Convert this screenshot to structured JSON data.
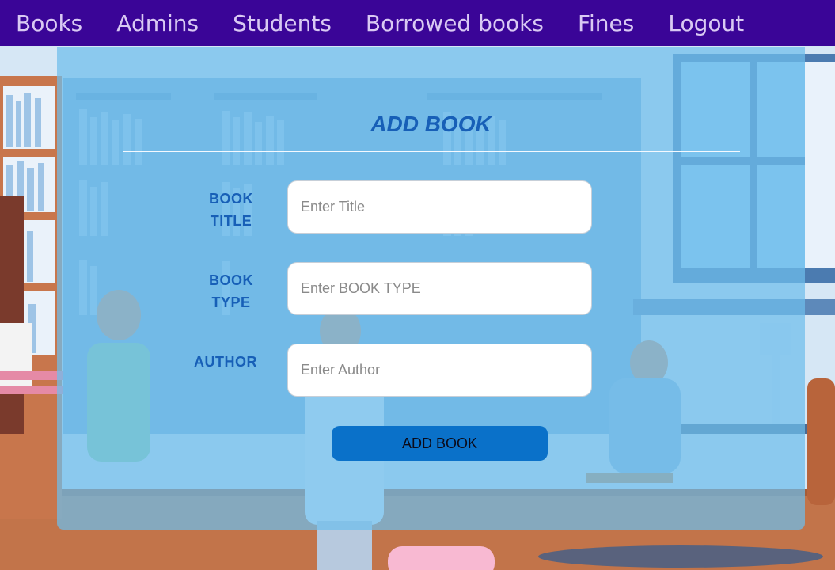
{
  "nav": {
    "items": [
      {
        "label": "Books"
      },
      {
        "label": "Admins"
      },
      {
        "label": "Students"
      },
      {
        "label": "Borrowed books"
      },
      {
        "label": "Fines"
      },
      {
        "label": "Logout"
      }
    ]
  },
  "form": {
    "title": "ADD BOOK",
    "fields": [
      {
        "label_line1": "BOOK",
        "label_line2": "TITLE",
        "placeholder": "Enter Title",
        "value": ""
      },
      {
        "label_line1": "BOOK",
        "label_line2": "TYPE",
        "placeholder": "Enter BOOK TYPE",
        "value": ""
      },
      {
        "label_line1": "AUTHOR",
        "label_line2": "",
        "placeholder": "Enter Author",
        "value": ""
      }
    ],
    "submit_label": "ADD BOOK"
  },
  "colors": {
    "navbar": "#3a0597",
    "nav_text": "#d9c9f3",
    "title_text": "#175fb7",
    "submit_button": "#0a71c9"
  }
}
